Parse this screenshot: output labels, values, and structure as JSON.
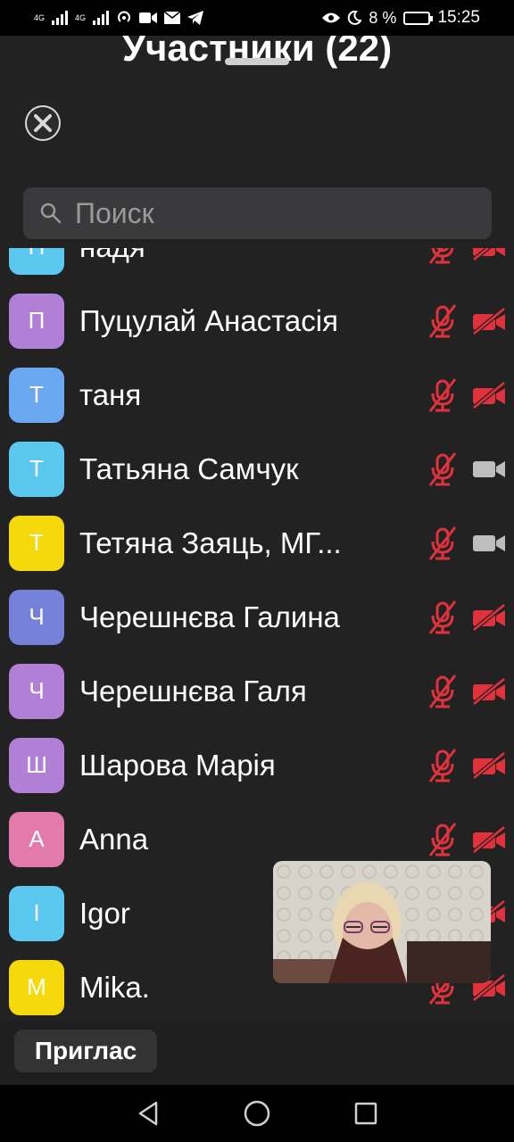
{
  "status_bar": {
    "signal_1": "4G",
    "signal_2": "4G",
    "battery_percent": "8 %",
    "time": "15:25"
  },
  "header": {
    "title": "Участники (22)"
  },
  "search": {
    "placeholder": "Поиск"
  },
  "participants": [
    {
      "initial": "Н",
      "name": "надя",
      "avatar_color": "#5bc8f0",
      "mic_muted": true,
      "cam_off": true
    },
    {
      "initial": "П",
      "name": "Пуцулай Анастасія",
      "avatar_color": "#b27fd6",
      "mic_muted": true,
      "cam_off": true
    },
    {
      "initial": "Т",
      "name": "таня",
      "avatar_color": "#6aa8f2",
      "mic_muted": true,
      "cam_off": true
    },
    {
      "initial": "Т",
      "name": "Татьяна Самчук",
      "avatar_color": "#5bc8f0",
      "mic_muted": true,
      "cam_off": false
    },
    {
      "initial": "Т",
      "name": "Тетяна Заяць, МГ...",
      "avatar_color": "#f5d90a",
      "mic_muted": true,
      "cam_off": false
    },
    {
      "initial": "Ч",
      "name": "Черешнєва Галина",
      "avatar_color": "#7581d8",
      "mic_muted": true,
      "cam_off": true
    },
    {
      "initial": "Ч",
      "name": "Черешнєва Галя",
      "avatar_color": "#b27fd6",
      "mic_muted": true,
      "cam_off": true
    },
    {
      "initial": "Ш",
      "name": "Шарова Марія",
      "avatar_color": "#b27fd6",
      "mic_muted": true,
      "cam_off": true
    },
    {
      "initial": "A",
      "name": "Anna",
      "avatar_color": "#e27aab",
      "mic_muted": true,
      "cam_off": true
    },
    {
      "initial": "I",
      "name": "Igor",
      "avatar_color": "#5bc8f0",
      "mic_muted": true,
      "cam_off": true
    },
    {
      "initial": "M",
      "name": "Mika.",
      "avatar_color": "#f5d90a",
      "mic_muted": true,
      "cam_off": true
    }
  ],
  "colors": {
    "muted_red": "#e0323c",
    "camera_on_gray": "#bdbdbd"
  },
  "bottom_bar": {
    "invite_label": "Приглас"
  }
}
